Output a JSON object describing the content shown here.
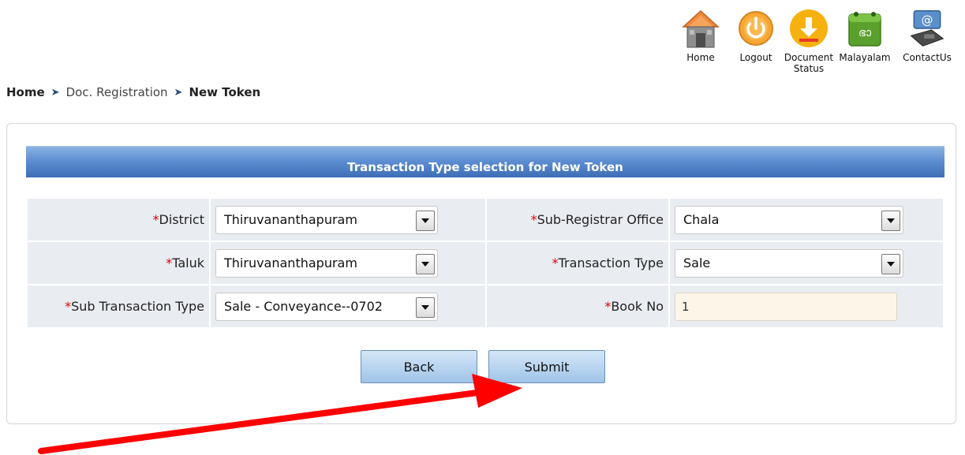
{
  "breadcrumb": {
    "home": "Home",
    "doc_registration": "Doc. Registration",
    "current": "New Token",
    "separator": "➤"
  },
  "topnav": {
    "home": "Home",
    "logout": "Logout",
    "document_status_line1": "Document",
    "document_status_line2": "Status",
    "malayalam": "Malayalam",
    "contact": "ContactUs",
    "malayalam_glyph": "ഭാ"
  },
  "panel": {
    "title": "Transaction Type selection for New Token"
  },
  "form": {
    "required_mark": "*",
    "district": {
      "label": "District",
      "value": "Thiruvananthapuram"
    },
    "sub_registrar_office": {
      "label": "Sub-Registrar Office",
      "value": "Chala"
    },
    "taluk": {
      "label": "Taluk",
      "value": "Thiruvananthapuram"
    },
    "transaction_type": {
      "label": "Transaction Type",
      "value": "Sale"
    },
    "sub_transaction_type": {
      "label": "Sub Transaction Type",
      "value": "Sale - Conveyance--0702"
    },
    "book_no": {
      "label": "Book No",
      "value": "1"
    }
  },
  "buttons": {
    "back": "Back",
    "submit": "Submit"
  },
  "colors": {
    "header_blue": "#3d6db6",
    "required_red": "#e00000",
    "annotation_arrow": "#ff0000",
    "book_input_bg": "#fdf6e8"
  },
  "icons": {
    "home": "home-icon",
    "logout": "power-icon",
    "document_status": "download-icon",
    "malayalam": "malayalam-calendar-icon",
    "contact": "contact-phone-icon",
    "breadcrumb_separator": "triangle-right-icon",
    "select_arrow": "chevron-down-icon"
  }
}
